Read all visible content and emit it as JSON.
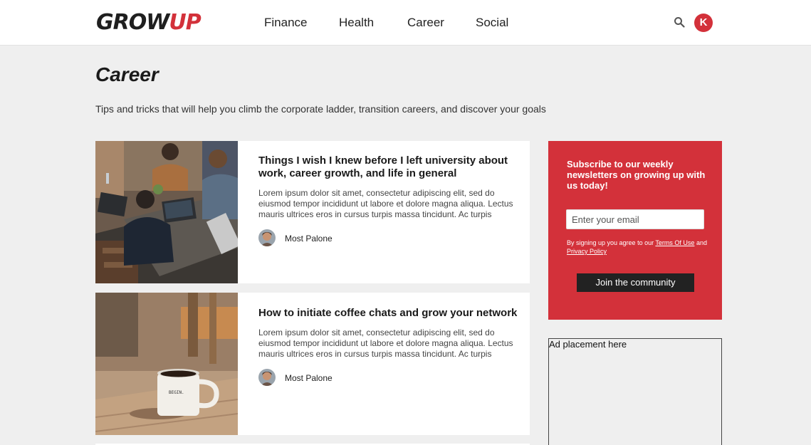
{
  "header": {
    "logo_part1": "GROW",
    "logo_part2": "UP",
    "nav": [
      "Finance",
      "Health",
      "Career",
      "Social"
    ],
    "user_initial": "K",
    "search_icon": "search-icon"
  },
  "page": {
    "title": "Career",
    "subtitle": "Tips and tricks that will help you climb the corporate ladder, transition careers, and discover your goals"
  },
  "articles": [
    {
      "title": "Things I wish I knew before I left university about work, career growth, and life in general",
      "excerpt": "Lorem ipsum dolor sit amet, consectetur adipiscing elit, sed do eiusmod tempor incididunt ut labore et dolore magna aliqua. Lectus mauris ultrices eros in cursus turpis massa tincidunt. Ac turpis eges...",
      "author": "Most Palone"
    },
    {
      "title": "How to initiate coffee chats and grow your network",
      "excerpt": "Lorem ipsum dolor sit amet, consectetur adipiscing elit, sed do eiusmod tempor incididunt ut labore et dolore magna aliqua. Lectus mauris ultrices eros in cursus turpis massa tincidunt. Ac turpis eges...",
      "author": "Most Palone",
      "mug_text": "BEGIN."
    }
  ],
  "subscribe": {
    "heading": "Subscribe to our weekly newsletters on growing up with us today!",
    "email_placeholder": "Enter your email",
    "legal_prefix": "By signing up you agree to our ",
    "terms_link": "Terms Of Use",
    "legal_and": " and ",
    "privacy_link": "Privacy Policy",
    "button": "Join the community"
  },
  "ad": {
    "text": "Ad placement here"
  },
  "colors": {
    "brand_red": "#d3313a",
    "page_bg": "#efefef",
    "button_dark": "#222222"
  }
}
